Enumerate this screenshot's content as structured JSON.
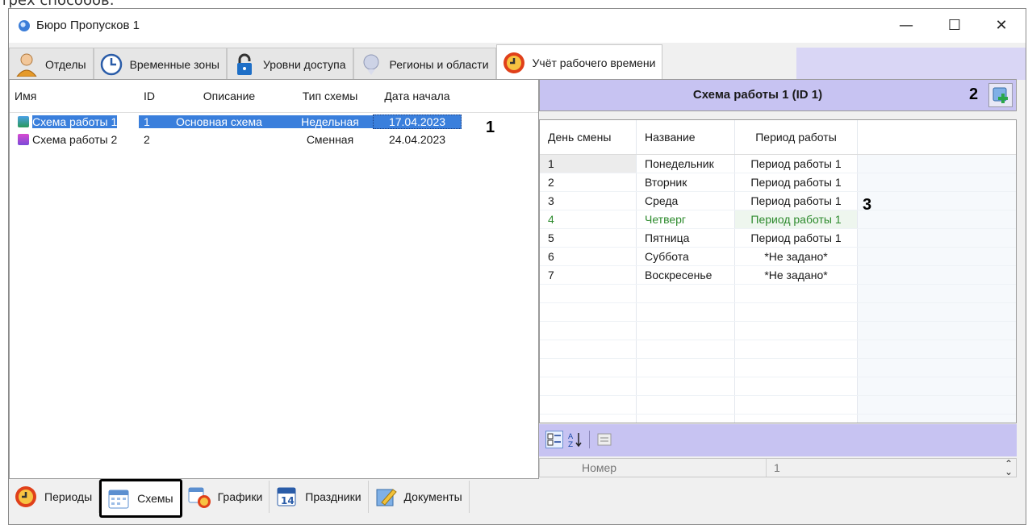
{
  "above_window_text": "трех способов:",
  "window": {
    "title": "Бюро Пропусков 1",
    "minimize": "—",
    "maximize": "☐",
    "close": "✕"
  },
  "top_tabs": [
    {
      "label": "Отделы",
      "icon": "person-icon"
    },
    {
      "label": "Временные зоны",
      "icon": "clock-icon"
    },
    {
      "label": "Уровни доступа",
      "icon": "lock-icon"
    },
    {
      "label": "Регионы и области",
      "icon": "region-icon"
    },
    {
      "label": "Учёт рабочего времени",
      "icon": "timesheet-icon",
      "active": true
    }
  ],
  "schemes_list": {
    "columns": [
      "Имя",
      "ID",
      "Описание",
      "Тип схемы",
      "Дата начала"
    ],
    "rows": [
      {
        "name": "Схема работы 1",
        "id": "1",
        "description": "Основная схема",
        "type": "Недельная",
        "start": "17.04.2023",
        "selected": true
      },
      {
        "name": "Схема работы 2",
        "id": "2",
        "description": "",
        "type": "Сменная",
        "start": "24.04.2023"
      }
    ]
  },
  "annotations": {
    "a1": "1",
    "a2": "2",
    "a3": "3"
  },
  "scheme_detail": {
    "title": "Схема работы 1 (ID 1)",
    "columns": [
      "День смены",
      "Название",
      "Период работы"
    ],
    "rows": [
      {
        "day": "1",
        "name": "Понедельник",
        "period": "Период работы 1"
      },
      {
        "day": "2",
        "name": "Вторник",
        "period": "Период работы 1"
      },
      {
        "day": "3",
        "name": "Среда",
        "period": "Период работы 1"
      },
      {
        "day": "4",
        "name": "Четверг",
        "period": "Период работы 1"
      },
      {
        "day": "5",
        "name": "Пятница",
        "period": "Период работы 1"
      },
      {
        "day": "6",
        "name": "Суббота",
        "period": "*Не задано*"
      },
      {
        "day": "7",
        "name": "Воскресенье",
        "period": "*Не задано*"
      }
    ]
  },
  "properties": {
    "label": "Номер",
    "value": "1"
  },
  "bottom_tabs": [
    {
      "label": "Периоды",
      "icon": "periods-icon"
    },
    {
      "label": "Схемы",
      "icon": "schemes-icon",
      "active": true
    },
    {
      "label": "Графики",
      "icon": "schedules-icon"
    },
    {
      "label": "Праздники",
      "icon": "holidays-icon"
    },
    {
      "label": "Документы",
      "icon": "documents-icon"
    }
  ],
  "colors": {
    "accent": "#3a7fdc",
    "panel_header": "#c7c3f2",
    "highlight_green": "#2e8b2e"
  }
}
